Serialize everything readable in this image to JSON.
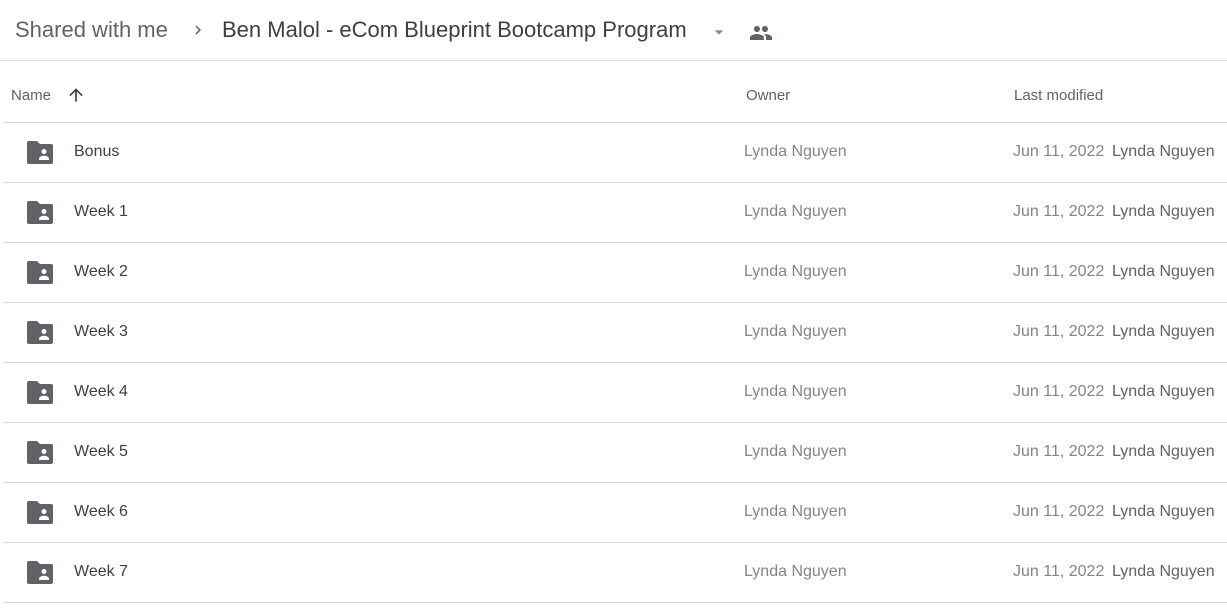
{
  "breadcrumb": {
    "root": "Shared with me",
    "current": "Ben Malol - eCom Blueprint Bootcamp Program",
    "separator_icon": "chevron-right-icon",
    "dropdown_icon": "caret-down-icon",
    "shared_icon": "people-icon"
  },
  "columns": {
    "name": "Name",
    "owner": "Owner",
    "last_modified": "Last modified",
    "sort_icon": "arrow-up-icon"
  },
  "files": [
    {
      "name": "Bonus",
      "owner": "Lynda Nguyen",
      "date": "Jun 11, 2022",
      "modified_by": "Lynda Nguyen",
      "icon": "shared-folder-icon"
    },
    {
      "name": "Week 1",
      "owner": "Lynda Nguyen",
      "date": "Jun 11, 2022",
      "modified_by": "Lynda Nguyen",
      "icon": "shared-folder-icon"
    },
    {
      "name": "Week 2",
      "owner": "Lynda Nguyen",
      "date": "Jun 11, 2022",
      "modified_by": "Lynda Nguyen",
      "icon": "shared-folder-icon"
    },
    {
      "name": "Week 3",
      "owner": "Lynda Nguyen",
      "date": "Jun 11, 2022",
      "modified_by": "Lynda Nguyen",
      "icon": "shared-folder-icon"
    },
    {
      "name": "Week 4",
      "owner": "Lynda Nguyen",
      "date": "Jun 11, 2022",
      "modified_by": "Lynda Nguyen",
      "icon": "shared-folder-icon"
    },
    {
      "name": "Week 5",
      "owner": "Lynda Nguyen",
      "date": "Jun 11, 2022",
      "modified_by": "Lynda Nguyen",
      "icon": "shared-folder-icon"
    },
    {
      "name": "Week 6",
      "owner": "Lynda Nguyen",
      "date": "Jun 11, 2022",
      "modified_by": "Lynda Nguyen",
      "icon": "shared-folder-icon"
    },
    {
      "name": "Week 7",
      "owner": "Lynda Nguyen",
      "date": "Jun 11, 2022",
      "modified_by": "Lynda Nguyen",
      "icon": "shared-folder-icon"
    }
  ],
  "colors": {
    "icon": "#5f6368",
    "divider": "#dadce0"
  }
}
